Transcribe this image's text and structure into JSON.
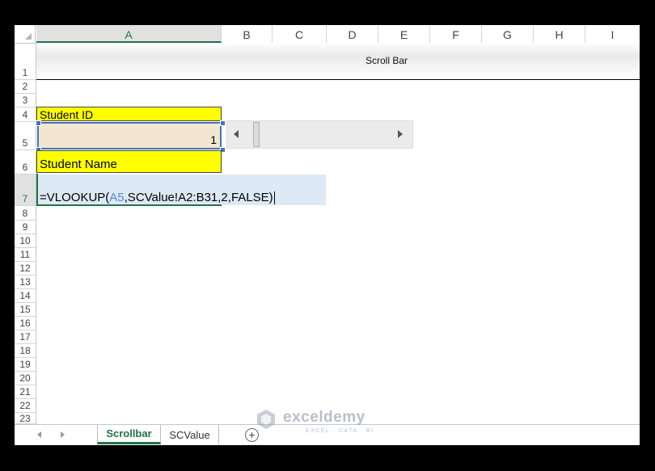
{
  "columns": [
    "A",
    "B",
    "C",
    "D",
    "E",
    "F",
    "G",
    "H",
    "I"
  ],
  "rows": [
    "1",
    "2",
    "3",
    "4",
    "5",
    "6",
    "7",
    "8",
    "9",
    "10",
    "11",
    "12",
    "13",
    "14",
    "15",
    "16",
    "17",
    "18",
    "19",
    "20",
    "21",
    "22",
    "23"
  ],
  "cells": {
    "title": "Scroll Bar",
    "a4": "Student ID",
    "a5": "1",
    "a6": "Student Name"
  },
  "formula": {
    "prefix": "=VLOOKUP(",
    "ref": "A5",
    "suffix": ",SCValue!A2:B31,2,FALSE)"
  },
  "scrollbar": {
    "value": 1
  },
  "tabs": {
    "active": "Scrollbar",
    "other": "SCValue",
    "add_label": "+"
  },
  "watermark": {
    "name": "exceldemy",
    "tagline": "EXCEL · DATA · BI"
  },
  "colors": {
    "excel_green": "#217346",
    "highlight_yellow": "#ffff00",
    "selection_blue": "#4472c4"
  }
}
